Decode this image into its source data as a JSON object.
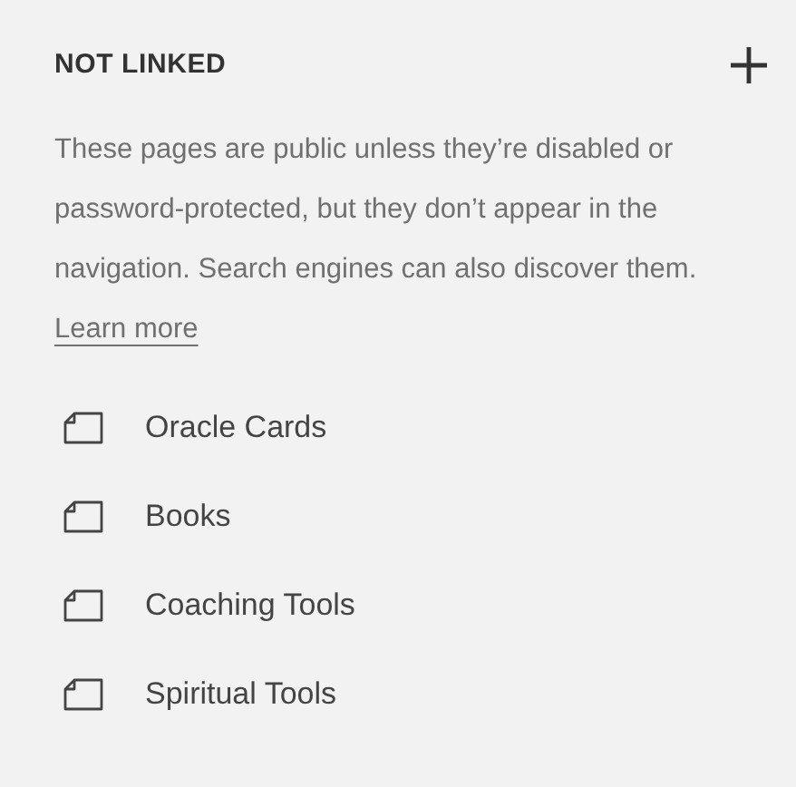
{
  "section": {
    "title": "NOT LINKED",
    "description": "These pages are public unless they’re disabled or password-protected, but they don’t appear in the navigation. Search engines can also discover them.",
    "link": "Learn more"
  },
  "pages": [
    {
      "label": "Oracle Cards"
    },
    {
      "label": "Books"
    },
    {
      "label": "Coaching Tools"
    },
    {
      "label": "Spiritual Tools"
    }
  ]
}
